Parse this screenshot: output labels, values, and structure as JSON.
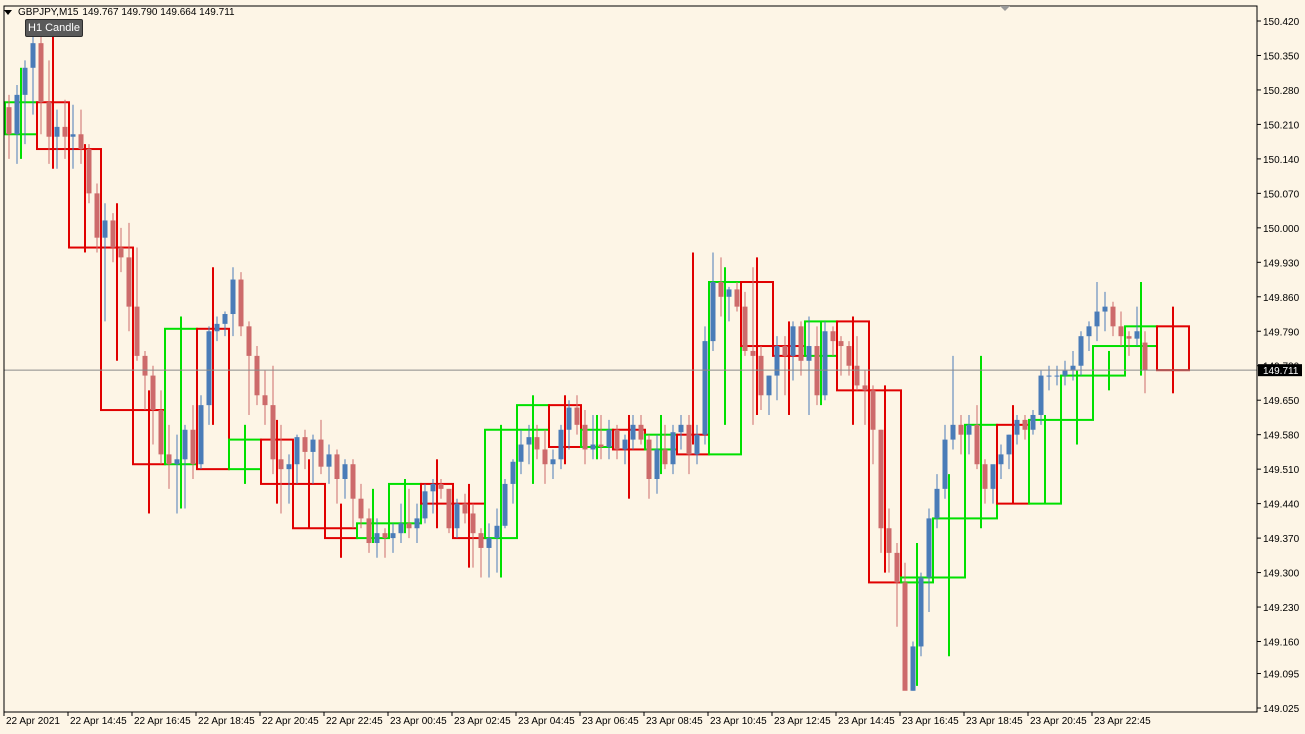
{
  "header": {
    "symbol_timeframe": "GBPJPY,M15",
    "ohlc": "149.767 149.790 149.664 149.711"
  },
  "button": {
    "label": "H1 Candle"
  },
  "colors": {
    "background": "#fdf5e6",
    "bull_body": "#4a7cb8",
    "bear_body": "#cd6b6b",
    "h1_bull": "#00e000",
    "h1_bear": "#e00000",
    "current_price_label_bg": "#000000"
  },
  "chart_data": {
    "type": "candlestick",
    "current_price": 149.711,
    "current_price_label": "149.711",
    "ylim": [
      149.025,
      150.42
    ],
    "y_ticks": [
      "150.420",
      "150.350",
      "150.280",
      "150.210",
      "150.140",
      "150.070",
      "150.000",
      "149.930",
      "149.860",
      "149.790",
      "149.720",
      "149.650",
      "149.580",
      "149.510",
      "149.440",
      "149.370",
      "149.300",
      "149.230",
      "149.160",
      "149.095",
      "149.025"
    ],
    "x_ticks": [
      "22 Apr 2021",
      "22 Apr 14:45",
      "22 Apr 16:45",
      "22 Apr 18:45",
      "22 Apr 20:45",
      "22 Apr 22:45",
      "23 Apr 00:45",
      "23 Apr 02:45",
      "23 Apr 04:45",
      "23 Apr 06:45",
      "23 Apr 08:45",
      "23 Apr 10:45",
      "23 Apr 12:45",
      "23 Apr 14:45",
      "23 Apr 16:45",
      "23 Apr 18:45",
      "23 Apr 20:45",
      "23 Apr 22:45"
    ],
    "m15_candles": [
      [
        150.245,
        150.27,
        150.14,
        150.19
      ],
      [
        150.19,
        150.29,
        150.13,
        150.27
      ],
      [
        150.27,
        150.34,
        150.17,
        150.325
      ],
      [
        150.325,
        150.4,
        150.23,
        150.375
      ],
      [
        150.375,
        150.42,
        150.19,
        150.255
      ],
      [
        150.255,
        150.34,
        150.13,
        150.185
      ],
      [
        150.185,
        150.24,
        150.12,
        150.205
      ],
      [
        150.205,
        150.26,
        150.14,
        150.185
      ],
      [
        150.185,
        150.25,
        150.12,
        150.19
      ],
      [
        150.19,
        150.24,
        150.13,
        150.16
      ],
      [
        150.16,
        150.17,
        150.05,
        150.07
      ],
      [
        150.07,
        150.09,
        149.95,
        149.98
      ],
      [
        149.98,
        150.05,
        149.81,
        150.015
      ],
      [
        150.015,
        150.03,
        149.93,
        149.96
      ],
      [
        149.96,
        150.0,
        149.91,
        149.94
      ],
      [
        149.94,
        150.01,
        149.79,
        149.84
      ],
      [
        149.84,
        149.96,
        149.73,
        149.74
      ],
      [
        149.74,
        149.75,
        149.63,
        149.7
      ],
      [
        149.7,
        149.72,
        149.56,
        149.63
      ],
      [
        149.63,
        149.67,
        149.52,
        149.54
      ],
      [
        149.54,
        149.6,
        149.47,
        149.52
      ],
      [
        149.52,
        149.58,
        149.42,
        149.53
      ],
      [
        149.53,
        149.6,
        149.43,
        149.59
      ],
      [
        149.59,
        149.64,
        149.49,
        149.52
      ],
      [
        149.52,
        149.66,
        149.51,
        149.64
      ],
      [
        149.64,
        149.8,
        149.6,
        149.79
      ],
      [
        149.79,
        149.82,
        149.77,
        149.805
      ],
      [
        149.805,
        149.83,
        149.78,
        149.825
      ],
      [
        149.825,
        149.92,
        149.78,
        149.895
      ],
      [
        149.895,
        149.91,
        149.78,
        149.8
      ],
      [
        149.8,
        149.81,
        149.62,
        149.74
      ],
      [
        149.74,
        149.76,
        149.64,
        149.66
      ],
      [
        149.66,
        149.71,
        149.6,
        149.64
      ],
      [
        149.64,
        149.72,
        149.5,
        149.53
      ],
      [
        149.53,
        149.6,
        149.42,
        149.51
      ],
      [
        149.51,
        149.54,
        149.44,
        149.52
      ],
      [
        149.52,
        149.58,
        149.48,
        149.575
      ],
      [
        149.575,
        149.59,
        149.51,
        149.545
      ],
      [
        149.545,
        149.58,
        149.48,
        149.57
      ],
      [
        149.57,
        149.61,
        149.5,
        149.515
      ],
      [
        149.515,
        149.56,
        149.48,
        149.54
      ],
      [
        149.54,
        149.55,
        149.44,
        149.49
      ],
      [
        149.49,
        149.53,
        149.45,
        149.52
      ],
      [
        149.52,
        149.53,
        149.39,
        149.45
      ],
      [
        149.45,
        149.48,
        149.39,
        149.41
      ],
      [
        149.41,
        149.43,
        149.34,
        149.36
      ],
      [
        149.36,
        149.41,
        149.33,
        149.38
      ],
      [
        149.38,
        149.39,
        149.33,
        149.37
      ],
      [
        149.37,
        149.4,
        149.34,
        149.38
      ],
      [
        149.38,
        149.44,
        149.36,
        149.4
      ],
      [
        149.4,
        149.47,
        149.37,
        149.39
      ],
      [
        149.39,
        149.44,
        149.36,
        149.41
      ],
      [
        149.41,
        149.48,
        149.4,
        149.465
      ],
      [
        149.465,
        149.49,
        149.42,
        149.48
      ],
      [
        149.48,
        149.49,
        149.45,
        149.47
      ],
      [
        149.47,
        149.47,
        149.38,
        149.39
      ],
      [
        149.39,
        149.45,
        149.37,
        149.44
      ],
      [
        149.44,
        149.46,
        149.4,
        149.42
      ],
      [
        149.42,
        149.44,
        149.31,
        149.38
      ],
      [
        149.38,
        149.39,
        149.29,
        149.35
      ],
      [
        149.35,
        149.4,
        149.29,
        149.37
      ],
      [
        149.37,
        149.43,
        149.3,
        149.395
      ],
      [
        149.395,
        149.49,
        149.39,
        149.48
      ],
      [
        149.48,
        149.53,
        149.44,
        149.525
      ],
      [
        149.525,
        149.59,
        149.5,
        149.56
      ],
      [
        149.56,
        149.6,
        149.52,
        149.575
      ],
      [
        149.575,
        149.6,
        149.53,
        149.55
      ],
      [
        149.55,
        149.59,
        149.48,
        149.52
      ],
      [
        149.52,
        149.55,
        149.49,
        149.53
      ],
      [
        149.53,
        149.6,
        149.51,
        149.59
      ],
      [
        149.59,
        149.65,
        149.55,
        149.635
      ],
      [
        149.635,
        149.66,
        149.58,
        149.6
      ],
      [
        149.6,
        149.63,
        149.52,
        149.55
      ],
      [
        149.55,
        149.62,
        149.53,
        149.56
      ],
      [
        149.56,
        149.62,
        149.53,
        149.555
      ],
      [
        149.555,
        149.61,
        149.53,
        149.59
      ],
      [
        149.59,
        149.6,
        149.53,
        149.55
      ],
      [
        149.55,
        149.58,
        149.52,
        149.57
      ],
      [
        149.57,
        149.62,
        149.55,
        149.6
      ],
      [
        149.6,
        149.62,
        149.56,
        149.57
      ],
      [
        149.57,
        149.58,
        149.45,
        149.49
      ],
      [
        149.49,
        149.58,
        149.46,
        149.55
      ],
      [
        149.55,
        149.6,
        149.51,
        149.52
      ],
      [
        149.52,
        149.6,
        149.5,
        149.585
      ],
      [
        149.585,
        149.62,
        149.55,
        149.6
      ],
      [
        149.6,
        149.62,
        149.5,
        149.54
      ],
      [
        149.54,
        149.6,
        149.52,
        149.58
      ],
      [
        149.58,
        149.8,
        149.56,
        149.77
      ],
      [
        149.77,
        149.95,
        149.75,
        149.89
      ],
      [
        149.89,
        149.94,
        149.82,
        149.86
      ],
      [
        149.86,
        149.88,
        149.81,
        149.875
      ],
      [
        149.875,
        149.89,
        149.83,
        149.84
      ],
      [
        149.84,
        149.87,
        149.74,
        149.75
      ],
      [
        149.75,
        149.92,
        149.6,
        149.74
      ],
      [
        149.74,
        149.76,
        149.63,
        149.66
      ],
      [
        149.66,
        149.7,
        149.62,
        149.7
      ],
      [
        149.7,
        149.78,
        149.65,
        149.76
      ],
      [
        149.76,
        149.78,
        149.66,
        149.74
      ],
      [
        149.74,
        149.81,
        149.69,
        149.8
      ],
      [
        149.8,
        149.81,
        149.7,
        149.73
      ],
      [
        149.73,
        149.82,
        149.62,
        149.76
      ],
      [
        149.76,
        149.8,
        149.64,
        149.66
      ],
      [
        149.66,
        149.81,
        149.65,
        149.79
      ],
      [
        149.79,
        149.8,
        149.74,
        149.77
      ],
      [
        149.77,
        149.78,
        149.7,
        149.76
      ],
      [
        149.76,
        149.77,
        149.7,
        149.72
      ],
      [
        149.72,
        149.78,
        149.67,
        149.68
      ],
      [
        149.68,
        149.71,
        149.6,
        149.67
      ],
      [
        149.67,
        149.68,
        149.52,
        149.59
      ],
      [
        149.59,
        149.59,
        149.34,
        149.39
      ],
      [
        149.39,
        149.43,
        149.3,
        149.34
      ],
      [
        149.34,
        149.36,
        149.19,
        149.28
      ],
      [
        149.28,
        149.32,
        149.07,
        149.06
      ],
      [
        149.06,
        149.16,
        149.06,
        149.15
      ],
      [
        149.15,
        149.3,
        149.13,
        149.29
      ],
      [
        149.29,
        149.43,
        149.22,
        149.41
      ],
      [
        149.41,
        149.5,
        149.39,
        149.47
      ],
      [
        149.47,
        149.6,
        149.45,
        149.57
      ],
      [
        149.57,
        149.74,
        149.55,
        149.6
      ],
      [
        149.6,
        149.62,
        149.54,
        149.58
      ],
      [
        149.58,
        149.62,
        149.54,
        149.6
      ],
      [
        149.6,
        149.64,
        149.51,
        149.52
      ],
      [
        149.52,
        149.53,
        149.44,
        149.47
      ],
      [
        149.47,
        149.51,
        149.44,
        149.52
      ],
      [
        149.52,
        149.56,
        149.49,
        149.54
      ],
      [
        149.54,
        149.58,
        149.51,
        149.58
      ],
      [
        149.58,
        149.62,
        149.56,
        149.61
      ],
      [
        149.61,
        149.62,
        149.57,
        149.59
      ],
      [
        149.59,
        149.63,
        149.58,
        149.62
      ],
      [
        149.62,
        149.71,
        149.6,
        149.7
      ],
      [
        149.7,
        149.72,
        149.67,
        149.7
      ],
      [
        149.7,
        149.72,
        149.68,
        149.7
      ],
      [
        149.7,
        149.73,
        149.68,
        149.71
      ],
      [
        149.71,
        149.75,
        149.69,
        149.72
      ],
      [
        149.72,
        149.79,
        149.7,
        149.78
      ],
      [
        149.78,
        149.81,
        149.75,
        149.8
      ],
      [
        149.8,
        149.89,
        149.77,
        149.83
      ],
      [
        149.83,
        149.87,
        149.79,
        149.84
      ],
      [
        149.84,
        149.85,
        149.78,
        149.8
      ],
      [
        149.8,
        149.83,
        149.76,
        149.78
      ],
      [
        149.78,
        149.79,
        149.74,
        149.775
      ],
      [
        149.775,
        149.84,
        149.76,
        149.79
      ],
      [
        149.767,
        149.79,
        149.664,
        149.711
      ]
    ],
    "h1_candles": [
      [
        150.19,
        150.325,
        150.14,
        150.255
      ],
      [
        150.255,
        150.4,
        150.12,
        150.16
      ],
      [
        150.16,
        150.17,
        149.95,
        149.96
      ],
      [
        149.96,
        150.05,
        149.73,
        149.63
      ],
      [
        149.63,
        149.67,
        149.42,
        149.52
      ],
      [
        149.52,
        149.82,
        149.43,
        149.795
      ],
      [
        149.795,
        149.92,
        149.6,
        149.51
      ],
      [
        149.51,
        149.6,
        149.48,
        149.57
      ],
      [
        149.57,
        149.61,
        149.44,
        149.48
      ],
      [
        149.48,
        149.53,
        149.39,
        149.39
      ],
      [
        149.39,
        149.44,
        149.33,
        149.37
      ],
      [
        149.37,
        149.47,
        149.36,
        149.4
      ],
      [
        149.4,
        149.49,
        149.38,
        149.48
      ],
      [
        149.48,
        149.53,
        149.39,
        149.44
      ],
      [
        149.44,
        149.48,
        149.31,
        149.37
      ],
      [
        149.37,
        149.6,
        149.29,
        149.59
      ],
      [
        149.59,
        149.66,
        149.48,
        149.64
      ],
      [
        149.64,
        149.66,
        149.52,
        149.555
      ],
      [
        149.555,
        149.62,
        149.53,
        149.59
      ],
      [
        149.59,
        149.62,
        149.45,
        149.55
      ],
      [
        149.55,
        149.62,
        149.5,
        149.58
      ],
      [
        149.58,
        149.95,
        149.56,
        149.54
      ],
      [
        149.54,
        149.92,
        149.6,
        149.89
      ],
      [
        149.89,
        149.94,
        149.62,
        149.76
      ],
      [
        149.76,
        149.81,
        149.62,
        149.74
      ],
      [
        149.74,
        149.81,
        149.64,
        149.81
      ],
      [
        149.81,
        149.82,
        149.6,
        149.67
      ],
      [
        149.67,
        149.68,
        149.3,
        149.28
      ],
      [
        149.28,
        149.36,
        149.07,
        149.29
      ],
      [
        149.29,
        149.5,
        149.13,
        149.41
      ],
      [
        149.41,
        149.74,
        149.39,
        149.6
      ],
      [
        149.6,
        149.64,
        149.44,
        149.44
      ],
      [
        149.44,
        149.62,
        149.44,
        149.61
      ],
      [
        149.61,
        149.71,
        149.56,
        149.7
      ],
      [
        149.7,
        149.75,
        149.67,
        149.76
      ],
      [
        149.76,
        149.89,
        149.7,
        149.8
      ],
      [
        149.8,
        149.84,
        149.664,
        149.711
      ]
    ]
  }
}
